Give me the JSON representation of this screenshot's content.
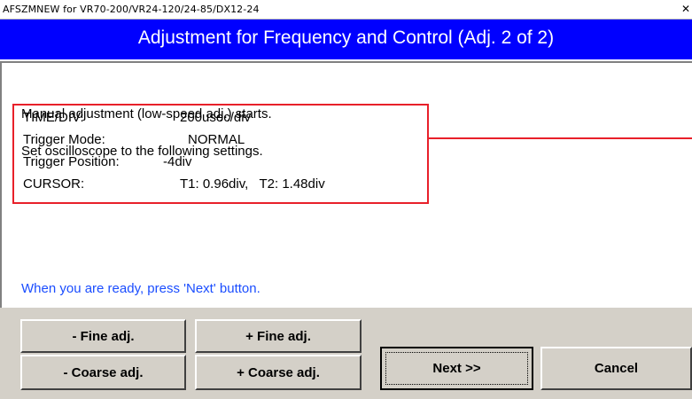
{
  "window": {
    "title": "AFSZMNEW for VR70-200/VR24-120/24-85/DX12-24",
    "close_glyph": "✕"
  },
  "header": {
    "title": "Adjustment for Frequency and Control (Adj. 2 of 2)"
  },
  "content": {
    "line1": "Manual adjustment (low-speed adj.) starts.",
    "line2": "Set oscilloscope to the following settings.",
    "settings": [
      {
        "label": "TIME/DIV:",
        "value": "200usec/div"
      },
      {
        "label": "Trigger Mode:",
        "value": "NORMAL"
      },
      {
        "label": "Trigger Position:",
        "value": "-4div"
      },
      {
        "label": "CURSOR:",
        "value": "T1: 0.96div,   T2: 1.48div"
      }
    ],
    "ready": "When you are ready, press 'Next' button."
  },
  "buttons": {
    "fine_minus": "- Fine adj.",
    "fine_plus": "+ Fine adj.",
    "coarse_minus": "- Coarse adj.",
    "coarse_plus": "+ Coarse adj.",
    "next": "Next >>",
    "cancel": "Cancel"
  },
  "colors": {
    "header_bg": "#0000ff",
    "box_border": "#e8202a",
    "ready_text": "#1a4dff",
    "dialog_bg": "#d4d0c8"
  }
}
